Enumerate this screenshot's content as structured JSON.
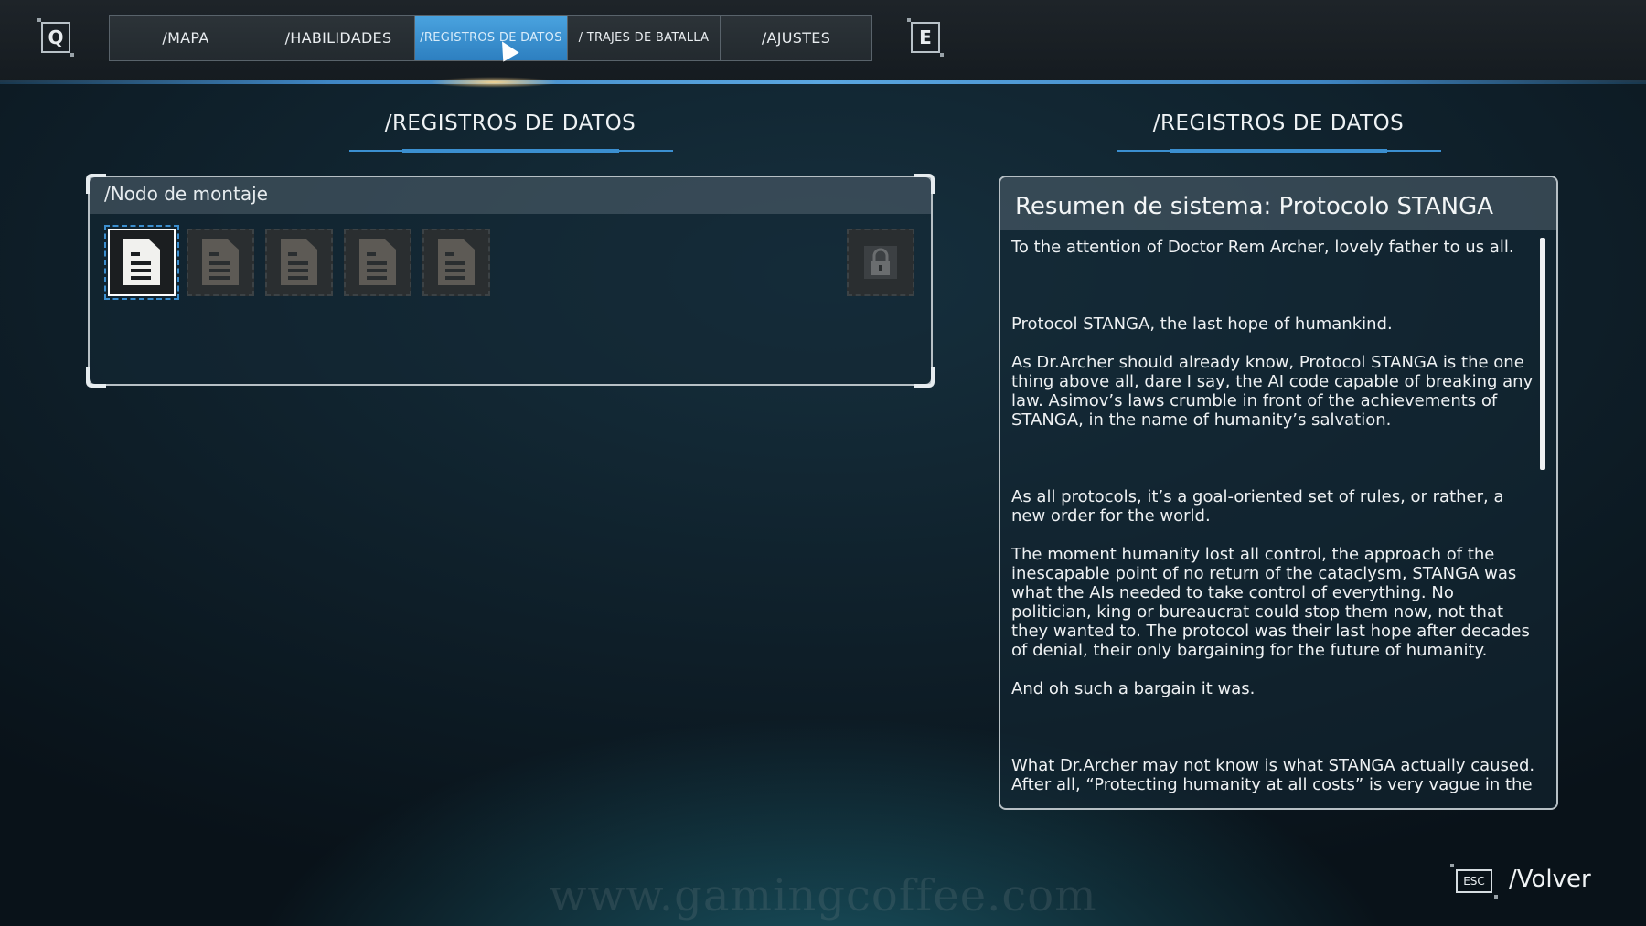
{
  "header": {
    "left_key": "Q",
    "right_key": "E",
    "tabs": [
      {
        "label": "/MAPA"
      },
      {
        "label": "/HABILIDADES"
      },
      {
        "label": "/REGISTROS DE DATOS"
      },
      {
        "label": "/ TRAJES DE BATALLA"
      },
      {
        "label": "/AJUSTES"
      }
    ],
    "active_tab": "/REGISTROS DE DATOS"
  },
  "left_panel": {
    "section_title": "/REGISTROS DE DATOS",
    "group_title": "/Nodo de montaje",
    "slots": [
      {
        "icon": "document-icon",
        "state": "selected"
      },
      {
        "icon": "document-icon",
        "state": "unread"
      },
      {
        "icon": "document-icon",
        "state": "unread"
      },
      {
        "icon": "document-icon",
        "state": "unread"
      },
      {
        "icon": "document-icon",
        "state": "unread"
      },
      {
        "icon": "locked-slot-icon",
        "state": "locked"
      }
    ]
  },
  "right_panel": {
    "section_title": "/REGISTROS DE DATOS",
    "document_title": "Resumen de sistema: Protocolo STANGA",
    "paragraphs": [
      "To the attention of Doctor Rem Archer, lovely father to us all.",
      "Protocol STANGA, the last hope of humankind.",
      "As Dr.Archer should already know, Protocol STANGA is the one thing above all, dare I say, the AI code capable of breaking any law. Asimov’s laws crumble in front of the achievements of STANGA, in the name of humanity’s salvation.",
      "As all protocols, it’s a goal-oriented set of rules, or rather, a new order for the world.",
      "The moment humanity lost all control, the approach of the inescapable point of no return of the cataclysm, STANGA was what the AIs needed to take control of everything. No politician, king or bureaucrat could stop them now, not that they wanted to. The protocol was their last hope after decades of denial, their only bargaining for the future of humanity.",
      "And oh such a bargain it was.",
      "What Dr.Archer may not know is what STANGA actually caused. After all, “Protecting humanity at all costs” is very vague in the"
    ]
  },
  "footer": {
    "esc_key": "ESC",
    "back_label": "/Volver",
    "watermark": "www.gamingcoffee.com"
  },
  "colors": {
    "accent": "#3b8fd0",
    "active_tab": "#2d7fc0"
  }
}
